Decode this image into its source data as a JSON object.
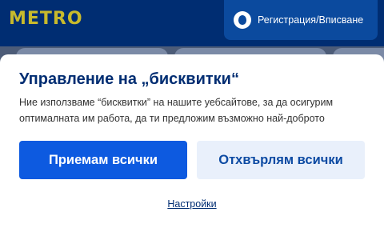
{
  "header": {
    "logo_text": "METRO",
    "auth_icon": "user-icon",
    "auth_label": "Регистрация/Вписване"
  },
  "cookie_dialog": {
    "title": "Управление на „бисквитки“",
    "text": "Ние използваме “бисквитки” на нашите уебсайтове, за да осигурим оптималната им работа, да ти предложим възможно най-доброто",
    "accept_label": "Приемам всички",
    "reject_label": "Отхвърлям всички",
    "settings_label": "Настройки"
  },
  "colors": {
    "header_bg": "#002d72",
    "logo": "#c8ba2c",
    "primary_button": "#0d5ae0",
    "secondary_button_bg": "#e9f0fb",
    "title_text": "#002d72"
  }
}
